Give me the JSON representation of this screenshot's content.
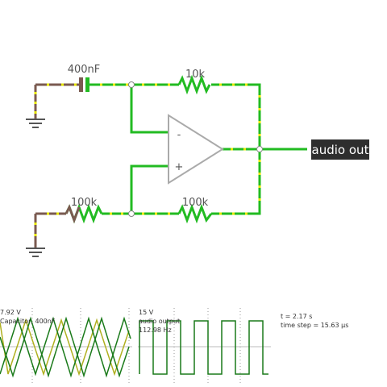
{
  "circuit": {
    "capacitor_label": "400nF",
    "feedback_resistor_label": "10k",
    "input_resistor_label": "100k",
    "positive_resistor_label": "100k",
    "opamp_minus": "-",
    "opamp_plus": "+",
    "output_label": "audio out"
  },
  "scopes": [
    {
      "value_line": "7.92 V",
      "name_line": "Capacitor, 400nF",
      "extra_line": ""
    },
    {
      "value_line": "15 V",
      "name_line": "audio output",
      "extra_line": "112.98 Hz"
    },
    {
      "value_line": "",
      "name_line": "",
      "extra_line": ""
    }
  ],
  "sim_info": {
    "time": "t = 2.17 s",
    "time_step": "time step = 15.63 μs"
  },
  "colors": {
    "wire_active": "#22bb22",
    "wire_ground": "#7a5a50",
    "current_dots": "#e8e800",
    "opamp": "#aaaaaa",
    "trace_dark": "#1a7a1a",
    "trace_yellow": "#b0b020"
  }
}
